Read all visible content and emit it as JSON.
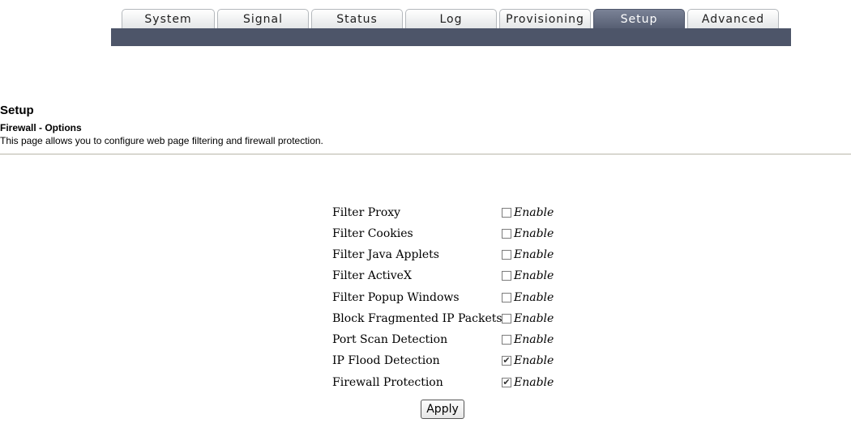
{
  "tabs": [
    {
      "label": "System",
      "active": false
    },
    {
      "label": "Signal",
      "active": false
    },
    {
      "label": "Status",
      "active": false
    },
    {
      "label": "Log",
      "active": false
    },
    {
      "label": "Provisioning",
      "active": false
    },
    {
      "label": "Setup",
      "active": true
    },
    {
      "label": "Advanced",
      "active": false
    }
  ],
  "header": {
    "title": "Setup",
    "section": "Firewall - Options",
    "description": "This page allows you to configure web page filtering and firewall protection."
  },
  "options": [
    {
      "label": "Filter Proxy",
      "enable_text": "Enable",
      "checked": false
    },
    {
      "label": "Filter Cookies",
      "enable_text": "Enable",
      "checked": false
    },
    {
      "label": "Filter Java Applets",
      "enable_text": "Enable",
      "checked": false
    },
    {
      "label": "Filter ActiveX",
      "enable_text": "Enable",
      "checked": false
    },
    {
      "label": "Filter Popup Windows",
      "enable_text": "Enable",
      "checked": false
    },
    {
      "label": "Block Fragmented IP Packets",
      "enable_text": "Enable",
      "checked": false
    },
    {
      "label": "Port Scan Detection",
      "enable_text": "Enable",
      "checked": false
    },
    {
      "label": "IP Flood Detection",
      "enable_text": "Enable",
      "checked": true
    },
    {
      "label": "Firewall Protection",
      "enable_text": "Enable",
      "checked": true
    }
  ],
  "apply_label": "Apply",
  "colors": {
    "nav_bar": "#4d5569",
    "active_tab": "#575f73"
  }
}
